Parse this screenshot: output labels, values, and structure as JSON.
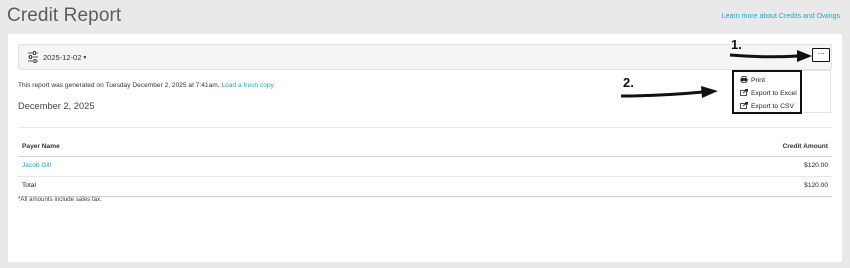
{
  "header": {
    "title": "Credit Report",
    "learn_more": "Learn more about Credits and Owings"
  },
  "toolbar": {
    "date": "2025-12-02",
    "more_label": "···"
  },
  "report": {
    "info_prefix": "This report was generated on Tuesday December 2, 2025 at 7:41am.",
    "fresh_link": "Load a fresh copy",
    "date_heading": "December 2, 2025"
  },
  "table": {
    "columns": [
      "Payer Name",
      "Credit Amount"
    ],
    "rows": [
      {
        "payer": "Jacob Gill",
        "amount": "$120.00"
      }
    ],
    "total_label": "Total",
    "total_amount": "$120.00",
    "footnote": "*All amounts include sales tax."
  },
  "menu": {
    "items": [
      "Print",
      "Export to Excel",
      "Export to CSV"
    ]
  },
  "annotations": {
    "step1": "1.",
    "step2": "2."
  },
  "colors": {
    "accent": "#1fa8c4",
    "background": "#e9e9e9"
  },
  "icons": {
    "filter": "sliders-icon",
    "print": "printer-icon",
    "export": "export-icon",
    "annotation": "arrow-right-icon"
  }
}
